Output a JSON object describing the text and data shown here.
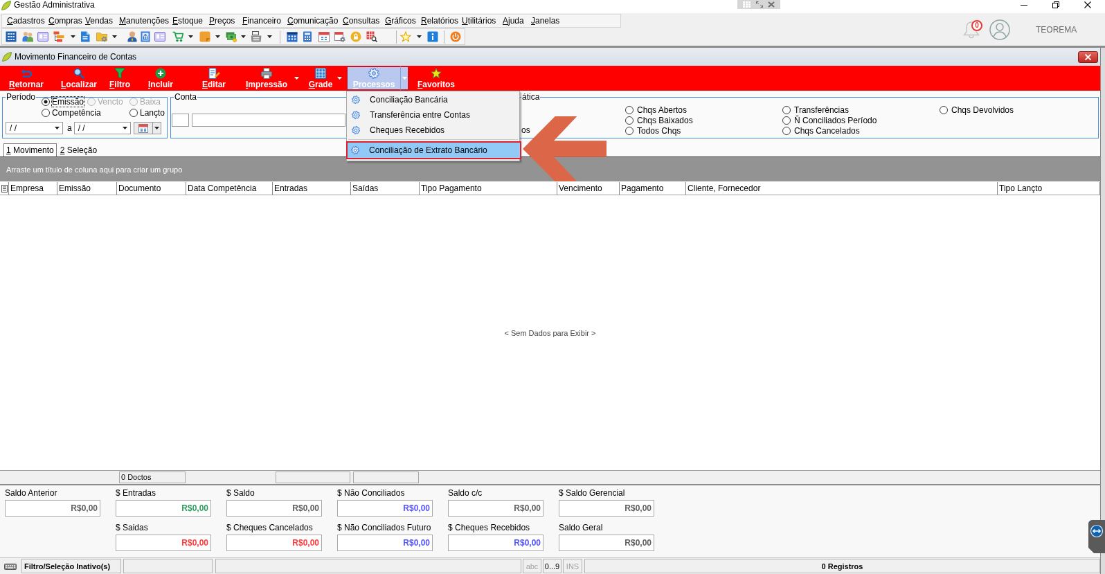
{
  "app_window": {
    "title": "Gestão Administrativa"
  },
  "menu_bar": [
    "Cadastros",
    "Compras",
    "Vendas",
    "Manutenções",
    "Estoque",
    "Preços",
    "Financeiro",
    "Comunicação",
    "Consultas",
    "Gráficos",
    "Relatórios",
    "Utilitários",
    "Ajuda",
    "Janelas"
  ],
  "user_area": {
    "notification_count": "0",
    "user_name": "TEOREMA"
  },
  "child_window": {
    "title": "Movimento Financeiro de Contas"
  },
  "action_bar": [
    {
      "label": "Retornar",
      "dropdown": false,
      "open": false
    },
    {
      "label": "Localizar",
      "dropdown": false,
      "open": false
    },
    {
      "label": "Filtro",
      "dropdown": false,
      "open": false
    },
    {
      "label": "Incluir",
      "dropdown": false,
      "open": false
    },
    {
      "label": "Editar",
      "dropdown": false,
      "open": false
    },
    {
      "label": "Impressão",
      "dropdown": true,
      "open": false
    },
    {
      "label": "Grade",
      "dropdown": true,
      "open": false
    },
    {
      "label": "Processos",
      "dropdown": true,
      "open": true
    },
    {
      "label": "Favoritos",
      "dropdown": false,
      "open": false
    }
  ],
  "processes_menu": {
    "groups": [
      {
        "items": [
          {
            "label": "Conciliação Bancária",
            "highlighted": false
          },
          {
            "label": "Transferência entre Contas",
            "highlighted": false
          },
          {
            "label": "Cheques Recebidos",
            "highlighted": false
          }
        ]
      },
      {
        "items": [
          {
            "label": "Conciliação de Extrato Bancário",
            "highlighted": true
          }
        ]
      }
    ]
  },
  "period": {
    "label": "Período",
    "options": [
      {
        "label": "Emissão",
        "selected": true,
        "disabled": false
      },
      {
        "label": "Vencto",
        "selected": false,
        "disabled": true
      },
      {
        "label": "Baixa",
        "selected": false,
        "disabled": true
      },
      {
        "label": "Competência",
        "selected": false,
        "disabled": false
      },
      {
        "label": "Lançto",
        "selected": false,
        "disabled": false
      }
    ],
    "date_from": "/ /",
    "range_separator": "a",
    "date_to": "/ /"
  },
  "account": {
    "label": "Conta"
  },
  "cheque_filter": {
    "label": "ática",
    "covered_option": "os",
    "options": [
      {
        "label": "Chqs Abertos",
        "selected": false
      },
      {
        "label": "Chqs Baixados",
        "selected": false
      },
      {
        "label": "Todos Chqs",
        "selected": false
      },
      {
        "label": "Transferências",
        "selected": false
      },
      {
        "label": "Ñ Conciliados Período",
        "selected": false
      },
      {
        "label": "Chqs Cancelados",
        "selected": false
      },
      {
        "label": "Chqs Devolvidos",
        "selected": false
      }
    ]
  },
  "tabs": [
    {
      "label": "1 Movimento",
      "selected": true
    },
    {
      "label": "2 Seleção",
      "selected": false
    }
  ],
  "grid": {
    "group_hint": "Arraste um título de coluna aqui para criar um grupo",
    "columns": [
      "Empresa",
      "Emissão",
      "Documento",
      "Data Competência",
      "Entradas",
      "Saídas",
      "Tipo Pagamento",
      "Vencimento",
      "Pagamento",
      "Cliente, Fornecedor",
      "Tipo Lançto"
    ],
    "empty_message": "< Sem Dados para Exibir >"
  },
  "grid_footer": {
    "document_count": "0 Doctos"
  },
  "summary": {
    "row_1": [
      {
        "label": "Saldo Anterior",
        "value": "R$0,00",
        "color": "#606060"
      },
      {
        "label": "$ Entradas",
        "value": "R$0,00",
        "color": "#2e9e5e"
      },
      {
        "label": "$ Saldo",
        "value": "R$0,00",
        "color": "#606060"
      },
      {
        "label": "$ Não Conciliados",
        "value": "R$0,00",
        "color": "#5454ff"
      },
      {
        "label": "Saldo c/c",
        "value": "R$0,00",
        "color": "#606060"
      },
      {
        "label": "$ Saldo Gerencial",
        "value": "R$0,00",
        "color": "#606060"
      }
    ],
    "row_2": [
      {
        "label": "$ Saidas",
        "value": "R$0,00",
        "color": "#ff3b3b"
      },
      {
        "label": "$ Cheques Cancelados",
        "value": "R$0,00",
        "color": "#ff3b3b"
      },
      {
        "label": "$ Não Conciliados Futuro",
        "value": "R$0,00",
        "color": "#5454ff"
      },
      {
        "label": "$ Cheques Recebidos",
        "value": "R$0,00",
        "color": "#5454ff"
      },
      {
        "label": "Saldo Geral",
        "value": "R$0,00",
        "color": "#606060"
      }
    ]
  },
  "status_bar": {
    "filter_state": "Filtro/Seleção Inativo(s)",
    "indicators": [
      {
        "label": "abc",
        "active": false
      },
      {
        "label": "0...9",
        "active": true
      },
      {
        "label": "INS",
        "active": false
      }
    ],
    "record_count": "0 Registros"
  }
}
